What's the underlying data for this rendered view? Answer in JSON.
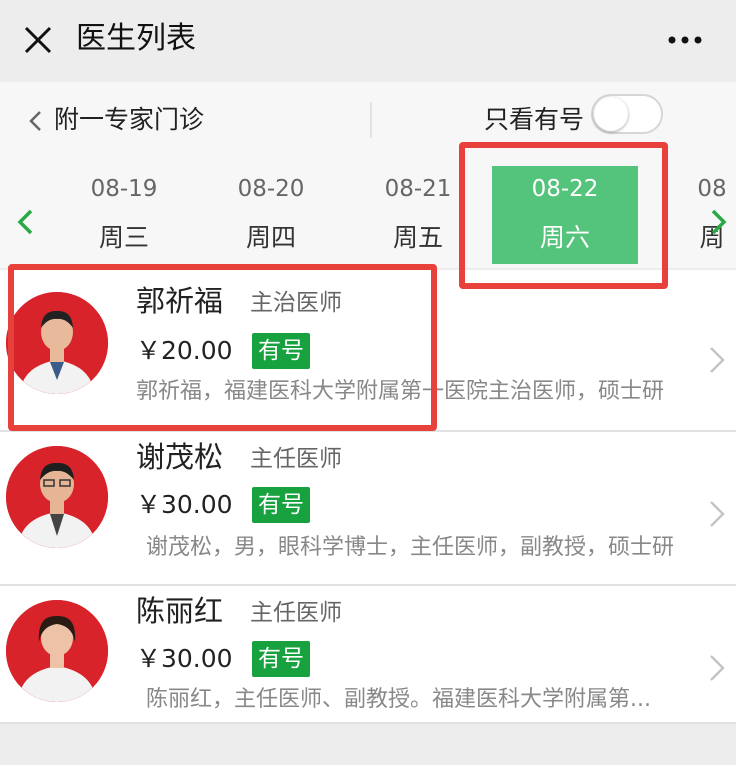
{
  "header": {
    "title": "医生列表",
    "close_icon": "close-icon",
    "more_icon": "more-icon"
  },
  "filter": {
    "department": "附一专家门诊",
    "only_available_label": "只看有号",
    "only_available_on": false
  },
  "dates": [
    {
      "date": "08-19",
      "weekday": "周三",
      "selected": false
    },
    {
      "date": "08-20",
      "weekday": "周四",
      "selected": false
    },
    {
      "date": "08-21",
      "weekday": "周五",
      "selected": false
    },
    {
      "date": "08-22",
      "weekday": "周六",
      "selected": true
    },
    {
      "date": "08",
      "weekday": "周",
      "selected": false
    }
  ],
  "doctors": [
    {
      "name": "郭祈福",
      "title": "主治医师",
      "price": "￥20.00",
      "badge": "有号",
      "desc": "郭祈福，福建医科大学附属第一医院主治医师，硕士研"
    },
    {
      "name": "谢茂松",
      "title": "主任医师",
      "price": "￥30.00",
      "badge": "有号",
      "desc": "谢茂松，男，眼科学博士，主任医师，副教授，硕士研"
    },
    {
      "name": "陈丽红",
      "title": "主任医师",
      "price": "￥30.00",
      "badge": "有号",
      "desc": "陈丽红，主任医师、副教授。福建医科大学附属第..."
    }
  ],
  "colors": {
    "accent_green": "#54c37b",
    "badge_green": "#18a13f",
    "highlight_red": "#e8413c",
    "avatar_red": "#d9232b"
  }
}
